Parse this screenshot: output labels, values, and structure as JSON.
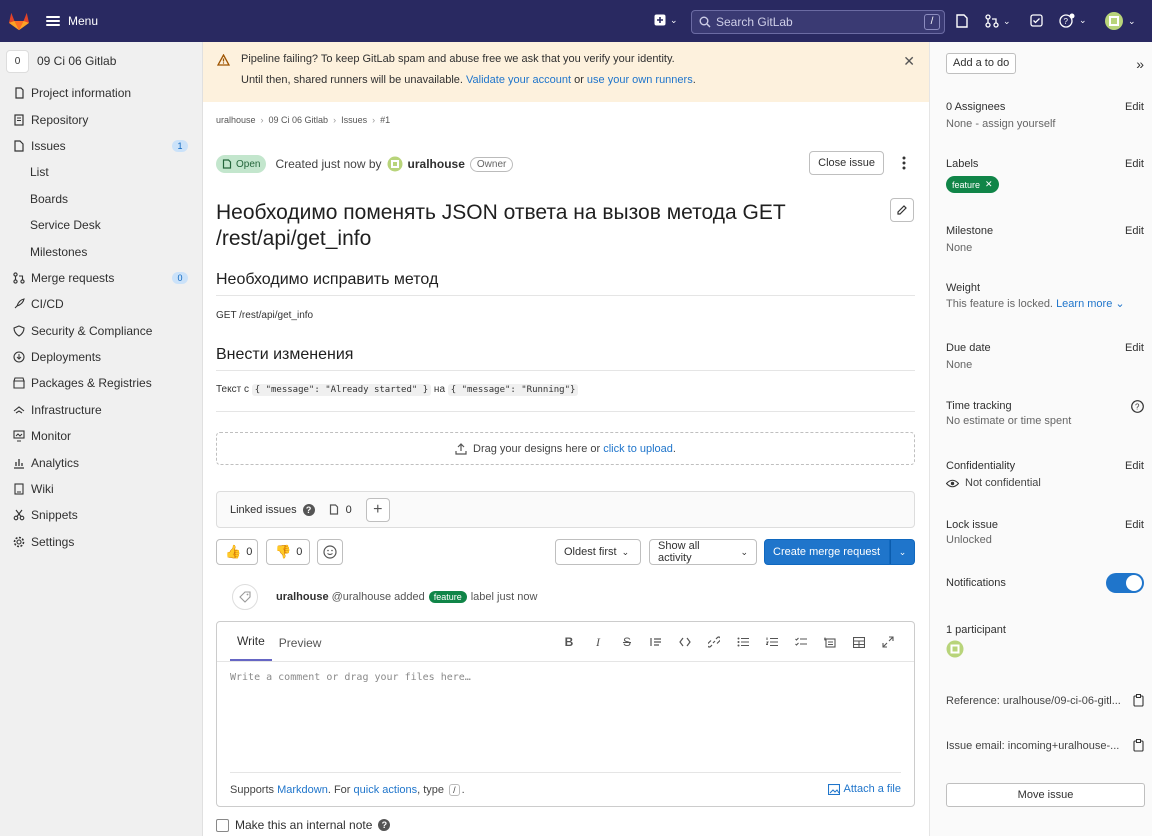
{
  "topbar": {
    "menu_label": "Menu",
    "search_placeholder": "Search GitLab",
    "search_key": "/"
  },
  "sidebar": {
    "project_initial": "0",
    "project_name": "09 Ci 06 Gitlab",
    "items": [
      {
        "label": "Project information",
        "icon": "info-icon"
      },
      {
        "label": "Repository",
        "icon": "doc-icon"
      },
      {
        "label": "Issues",
        "icon": "issues-icon",
        "count": "1"
      },
      {
        "label": "List",
        "sub": true
      },
      {
        "label": "Boards",
        "sub": true
      },
      {
        "label": "Service Desk",
        "sub": true
      },
      {
        "label": "Milestones",
        "sub": true
      },
      {
        "label": "Merge requests",
        "icon": "merge-icon",
        "count": "0"
      },
      {
        "label": "CI/CD",
        "icon": "rocket-icon"
      },
      {
        "label": "Security & Compliance",
        "icon": "shield-icon"
      },
      {
        "label": "Deployments",
        "icon": "deploy-icon"
      },
      {
        "label": "Packages & Registries",
        "icon": "package-icon"
      },
      {
        "label": "Infrastructure",
        "icon": "cloud-icon"
      },
      {
        "label": "Monitor",
        "icon": "monitor-icon"
      },
      {
        "label": "Analytics",
        "icon": "chart-icon"
      },
      {
        "label": "Wiki",
        "icon": "book-icon"
      },
      {
        "label": "Snippets",
        "icon": "scissors-icon"
      },
      {
        "label": "Settings",
        "icon": "gear-icon"
      }
    ]
  },
  "alert": {
    "line1": "Pipeline failing? To keep GitLab spam and abuse free we ask that you verify your identity.",
    "line2_pre": "Until then, shared runners will be unavailable.",
    "validate_link": "Validate your account",
    "or": "or",
    "runners_link": "use your own runners",
    "dot": "."
  },
  "breadcrumb": [
    "uralhouse",
    "09 Ci 06 Gitlab",
    "Issues",
    "#1"
  ],
  "issue": {
    "status": "Open",
    "created_text": "Created just now by",
    "author": "uralhouse",
    "role": "Owner",
    "close_label": "Close issue",
    "title": "Необходимо поменять JSON ответа на вызов метода GET /rest/api/get_info",
    "h1": "Необходимо исправить метод",
    "p1": "GET /rest/api/get_info",
    "h2": "Внести изменения",
    "p2_pre": "Текст с",
    "p2_code1": "{ \"message\": \"Already started\" }",
    "p2_mid": "на",
    "p2_code2": "{ \"message\": \"Running\"}",
    "drop_text": "Drag your designs here or",
    "drop_link": "click to upload",
    "drop_dot": ".",
    "linked_label": "Linked issues",
    "linked_count": "0"
  },
  "actions": {
    "thumbs_up": "0",
    "thumbs_down": "0",
    "sort_label": "Oldest first",
    "filter_label": "Show all activity",
    "create_mr": "Create merge request"
  },
  "activity": {
    "user": "uralhouse",
    "handle": "@uralhouse added",
    "label": "feature",
    "suffix": "label just now"
  },
  "editor": {
    "tab_write": "Write",
    "tab_preview": "Preview",
    "placeholder": "Write a comment or drag your files here…",
    "tools": [
      "B",
      "I",
      "S"
    ],
    "foot_pre": "Supports",
    "foot_md": "Markdown",
    "foot_mid": ". For",
    "foot_qa": "quick actions",
    "foot_type": ", type",
    "foot_key": "/",
    "foot_dot": ".",
    "attach": "Attach a file",
    "internal_note": "Make this an internal note"
  },
  "rsidebar": {
    "todo": "Add a to do",
    "assignees_title": "0 Assignees",
    "assignees_value": "None - assign yourself",
    "labels_title": "Labels",
    "label_value": "feature",
    "milestone_title": "Milestone",
    "milestone_value": "None",
    "weight_title": "Weight",
    "weight_value": "This feature is locked.",
    "weight_link": "Learn more",
    "due_title": "Due date",
    "due_value": "None",
    "time_title": "Time tracking",
    "time_value": "No estimate or time spent",
    "conf_title": "Confidentiality",
    "conf_value": "Not confidential",
    "lock_title": "Lock issue",
    "lock_value": "Unlocked",
    "notif_title": "Notifications",
    "participants_title": "1 participant",
    "reference": "Reference: uralhouse/09-ci-06-gitl...",
    "issue_email": "Issue email: incoming+uralhouse-...",
    "edit": "Edit",
    "move": "Move issue"
  },
  "colors": {
    "topbar": "#292961",
    "primary": "#1f75cb",
    "label_green": "#108548",
    "alert_bg": "#fdf1dd"
  }
}
